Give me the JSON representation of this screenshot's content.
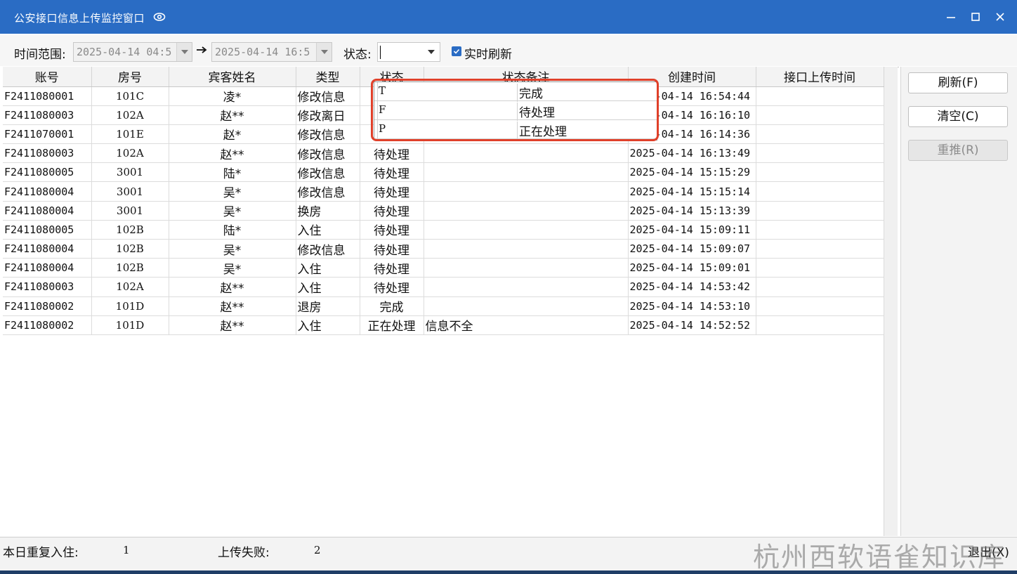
{
  "window": {
    "title": "公安接口信息上传监控窗口",
    "accent": "#2a6cc4"
  },
  "toolbar": {
    "time_range_label": "时间范围:",
    "start_datetime": "2025-04-14 04:5",
    "end_datetime": "2025-04-14 16:5",
    "status_label": "状态:",
    "status_value": "",
    "realtime_label": "实时刷新",
    "realtime_checked": true
  },
  "grid": {
    "columns": [
      "账号",
      "房号",
      "宾客姓名",
      "类型",
      "状态",
      "状态备注",
      "创建时间",
      "接口上传时间"
    ],
    "rows": [
      [
        "F2411080001",
        "101C",
        "凌*",
        "修改信息",
        "",
        "",
        "2025-04-14 16:54:44",
        ""
      ],
      [
        "F2411080003",
        "102A",
        "赵**",
        "修改离日",
        "",
        "",
        "2025-04-14 16:16:10",
        ""
      ],
      [
        "F2411070001",
        "101E",
        "赵*",
        "修改信息",
        "",
        "",
        "2025-04-14 16:14:36",
        ""
      ],
      [
        "F2411080003",
        "102A",
        "赵**",
        "修改信息",
        "待处理",
        "",
        "2025-04-14 16:13:49",
        ""
      ],
      [
        "F2411080005",
        "3001",
        "陆*",
        "修改信息",
        "待处理",
        "",
        "2025-04-14 15:15:29",
        ""
      ],
      [
        "F2411080004",
        "3001",
        "吴*",
        "修改信息",
        "待处理",
        "",
        "2025-04-14 15:15:14",
        ""
      ],
      [
        "F2411080004",
        "3001",
        "吴*",
        "换房",
        "待处理",
        "",
        "2025-04-14 15:13:39",
        ""
      ],
      [
        "F2411080005",
        "102B",
        "陆*",
        "入住",
        "待处理",
        "",
        "2025-04-14 15:09:11",
        ""
      ],
      [
        "F2411080004",
        "102B",
        "吴*",
        "修改信息",
        "待处理",
        "",
        "2025-04-14 15:09:07",
        ""
      ],
      [
        "F2411080004",
        "102B",
        "吴*",
        "入住",
        "待处理",
        "",
        "2025-04-14 15:09:01",
        ""
      ],
      [
        "F2411080003",
        "102A",
        "赵**",
        "入住",
        "待处理",
        "",
        "2025-04-14 14:53:42",
        ""
      ],
      [
        "F2411080002",
        "101D",
        "赵**",
        "退房",
        "完成",
        "",
        "2025-04-14 14:53:10",
        ""
      ],
      [
        "F2411080002",
        "101D",
        "赵**",
        "入住",
        "正在处理",
        "信息不全",
        "2025-04-14 14:52:52",
        ""
      ]
    ]
  },
  "status_dropdown": {
    "options": [
      {
        "key": "T",
        "label": "完成"
      },
      {
        "key": "F",
        "label": "待处理"
      },
      {
        "key": "P",
        "label": "正在处理"
      }
    ],
    "highlight_color": "#e0402a"
  },
  "side_buttons": {
    "refresh": "刷新(F)",
    "clear": "清空(C)",
    "repush": "重推(R)"
  },
  "statusbar": {
    "repeat_checkin_label": "本日重复入住:",
    "repeat_checkin_value": "1",
    "upload_fail_label": "上传失败:",
    "upload_fail_value": "2",
    "exit_label": "退出(X)"
  },
  "watermark": "杭州西软语雀知识库"
}
